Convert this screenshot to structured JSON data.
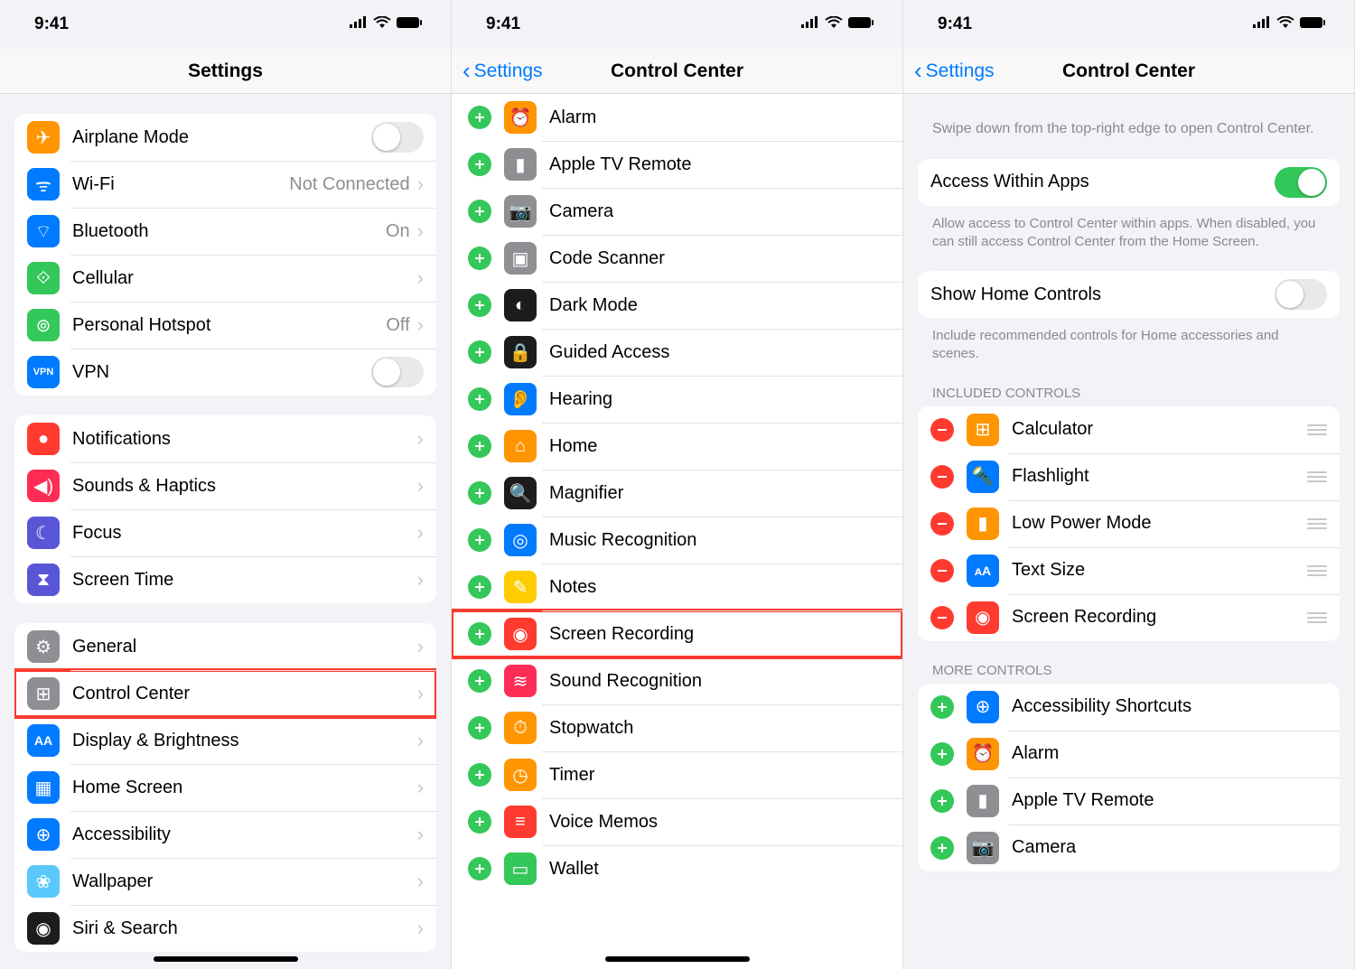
{
  "status": {
    "time": "9:41"
  },
  "phone1": {
    "title": "Settings",
    "group1": [
      {
        "key": "airplane",
        "label": "Airplane Mode",
        "color": "c-orange",
        "toggle": false
      },
      {
        "key": "wifi",
        "label": "Wi-Fi",
        "color": "c-blue",
        "detail": "Not Connected"
      },
      {
        "key": "bluetooth",
        "label": "Bluetooth",
        "color": "c-blue",
        "detail": "On"
      },
      {
        "key": "cellular",
        "label": "Cellular",
        "color": "c-green"
      },
      {
        "key": "hotspot",
        "label": "Personal Hotspot",
        "color": "c-green",
        "detail": "Off"
      },
      {
        "key": "vpn",
        "label": "VPN",
        "color": "c-blue",
        "toggle": false,
        "iconText": "VPN"
      }
    ],
    "group2": [
      {
        "key": "notifications",
        "label": "Notifications",
        "color": "c-red"
      },
      {
        "key": "sounds",
        "label": "Sounds & Haptics",
        "color": "c-pink"
      },
      {
        "key": "focus",
        "label": "Focus",
        "color": "c-indigo"
      },
      {
        "key": "screentime",
        "label": "Screen Time",
        "color": "c-indigo"
      }
    ],
    "group3": [
      {
        "key": "general",
        "label": "General",
        "color": "c-gray"
      },
      {
        "key": "controlcenter",
        "label": "Control Center",
        "color": "c-gray",
        "highlight": true
      },
      {
        "key": "display",
        "label": "Display & Brightness",
        "color": "c-blue"
      },
      {
        "key": "homescreen",
        "label": "Home Screen",
        "color": "c-blue"
      },
      {
        "key": "accessibility",
        "label": "Accessibility",
        "color": "c-blue"
      },
      {
        "key": "wallpaper",
        "label": "Wallpaper",
        "color": "c-teal"
      },
      {
        "key": "siri",
        "label": "Siri & Search",
        "color": "c-dark"
      }
    ]
  },
  "phone2": {
    "back": "Settings",
    "title": "Control Center",
    "items": [
      {
        "key": "alarm",
        "label": "Alarm",
        "color": "c-orange"
      },
      {
        "key": "appletv",
        "label": "Apple TV Remote",
        "color": "c-gray"
      },
      {
        "key": "camera",
        "label": "Camera",
        "color": "c-gray"
      },
      {
        "key": "codescanner",
        "label": "Code Scanner",
        "color": "c-gray"
      },
      {
        "key": "darkmode",
        "label": "Dark Mode",
        "color": "c-dark"
      },
      {
        "key": "guided",
        "label": "Guided Access",
        "color": "c-dark"
      },
      {
        "key": "hearing",
        "label": "Hearing",
        "color": "c-blue"
      },
      {
        "key": "home",
        "label": "Home",
        "color": "c-orange"
      },
      {
        "key": "magnifier",
        "label": "Magnifier",
        "color": "c-dark"
      },
      {
        "key": "music",
        "label": "Music Recognition",
        "color": "c-blue"
      },
      {
        "key": "notes",
        "label": "Notes",
        "color": "c-yellow"
      },
      {
        "key": "screenrec",
        "label": "Screen Recording",
        "color": "c-red",
        "highlight": true
      },
      {
        "key": "soundrec",
        "label": "Sound Recognition",
        "color": "c-pink"
      },
      {
        "key": "stopwatch",
        "label": "Stopwatch",
        "color": "c-orange"
      },
      {
        "key": "timer",
        "label": "Timer",
        "color": "c-orange"
      },
      {
        "key": "voicememos",
        "label": "Voice Memos",
        "color": "c-red"
      },
      {
        "key": "wallet",
        "label": "Wallet",
        "color": "c-green"
      }
    ]
  },
  "phone3": {
    "back": "Settings",
    "title": "Control Center",
    "intro": "Swipe down from the top-right edge to open Control Center.",
    "access_label": "Access Within Apps",
    "access_footer": "Allow access to Control Center within apps. When disabled, you can still access Control Center from the Home Screen.",
    "home_label": "Show Home Controls",
    "home_footer": "Include recommended controls for Home accessories and scenes.",
    "included_header": "INCLUDED CONTROLS",
    "included": [
      {
        "key": "calculator",
        "label": "Calculator",
        "color": "c-orange"
      },
      {
        "key": "flashlight",
        "label": "Flashlight",
        "color": "c-blue"
      },
      {
        "key": "lowpower",
        "label": "Low Power Mode",
        "color": "c-orange"
      },
      {
        "key": "textsize",
        "label": "Text Size",
        "color": "c-blue"
      },
      {
        "key": "screenrec",
        "label": "Screen Recording",
        "color": "c-red"
      }
    ],
    "more_header": "MORE CONTROLS",
    "more": [
      {
        "key": "a11yshortcuts",
        "label": "Accessibility Shortcuts",
        "color": "c-blue"
      },
      {
        "key": "alarm",
        "label": "Alarm",
        "color": "c-orange"
      },
      {
        "key": "appletv",
        "label": "Apple TV Remote",
        "color": "c-gray"
      },
      {
        "key": "camera",
        "label": "Camera",
        "color": "c-gray"
      }
    ]
  }
}
